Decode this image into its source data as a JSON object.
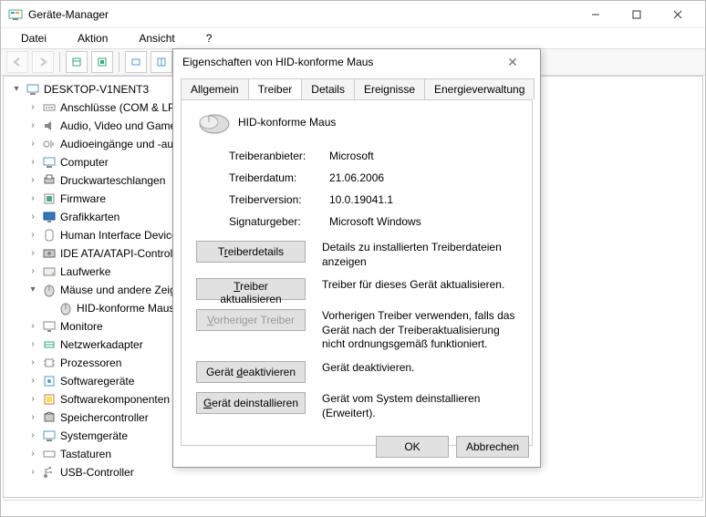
{
  "window": {
    "title": "Geräte-Manager"
  },
  "menubar": {
    "file": "Datei",
    "action": "Aktion",
    "view": "Ansicht",
    "help": "?"
  },
  "tree": {
    "root": "DESKTOP-V1NENT3",
    "nodes": {
      "ports": "Anschlüsse (COM & LPT)",
      "audio": "Audio, Video und Gamecontroller",
      "audioio": "Audioeingänge und -ausgänge",
      "computer": "Computer",
      "printq": "Druckwarteschlangen",
      "firmware": "Firmware",
      "display": "Grafikkarten",
      "hid": "Human Interface Devices",
      "ide": "IDE ATA/ATAPI-Controller",
      "drives": "Laufwerke",
      "mice": "Mäuse und andere Zeigegeräte",
      "mouse_hid": "HID-konforme Maus",
      "monitors": "Monitore",
      "network": "Netzwerkadapter",
      "cpu": "Prozessoren",
      "software_dev": "Softwaregeräte",
      "software_comp": "Softwarekomponenten",
      "storage": "Speichercontroller",
      "system": "Systemgeräte",
      "keyboards": "Tastaturen",
      "usb": "USB-Controller"
    }
  },
  "dialog": {
    "title": "Eigenschaften von HID-konforme Maus",
    "tabs": {
      "general": "Allgemein",
      "driver": "Treiber",
      "details": "Details",
      "events": "Ereignisse",
      "power": "Energieverwaltung"
    },
    "device_name": "HID-konforme Maus",
    "props": {
      "provider_label": "Treiberanbieter:",
      "provider_value": "Microsoft",
      "date_label": "Treiberdatum:",
      "date_value": "21.06.2006",
      "version_label": "Treiberversion:",
      "version_value": "10.0.19041.1",
      "signer_label": "Signaturgeber:",
      "signer_value": "Microsoft Windows"
    },
    "actions": {
      "details_btn": "Treiberdetails",
      "details_desc": "Details zu installierten Treiberdateien anzeigen",
      "update_btn": "Treiber aktualisieren",
      "update_desc": "Treiber für dieses Gerät aktualisieren.",
      "rollback_btn": "Vorheriger Treiber",
      "rollback_desc": "Vorherigen Treiber verwenden, falls das Gerät nach der Treiberaktualisierung nicht ordnungsgemäß funktioniert.",
      "disable_btn": "Gerät deaktivieren",
      "disable_desc": "Gerät deaktivieren.",
      "uninstall_btn": "Gerät deinstallieren",
      "uninstall_desc": "Gerät vom System deinstallieren (Erweitert)."
    },
    "buttons": {
      "ok": "OK",
      "cancel": "Abbrechen"
    }
  }
}
